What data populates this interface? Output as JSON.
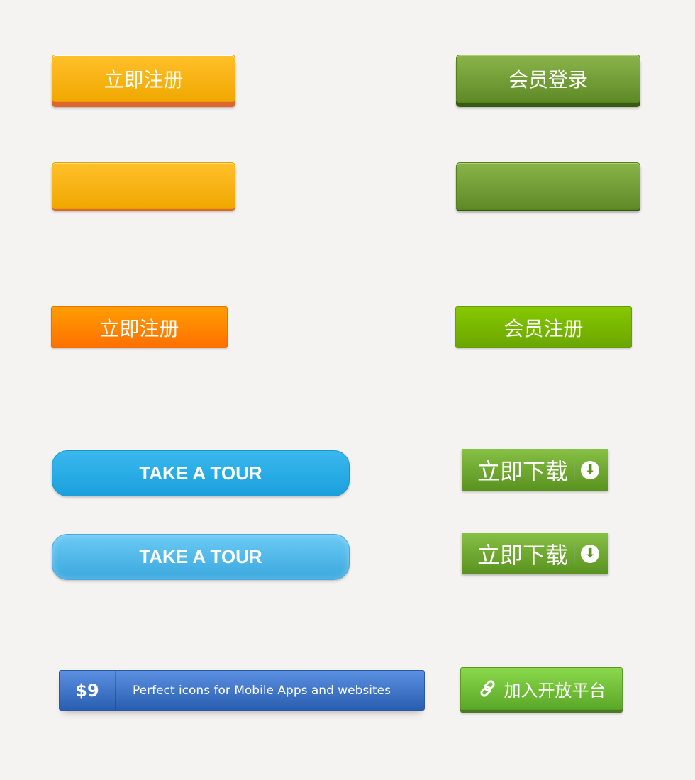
{
  "buttons": {
    "register_3d": "立即注册",
    "login_3d": "会员登录",
    "register_flat": "立即注册",
    "member_register_flat": "会员注册",
    "tour_1": "TAKE A TOUR",
    "tour_2": "TAKE A TOUR",
    "download_1": "立即下载",
    "download_2": "立即下载",
    "price": "$9",
    "banner_text": "Perfect icons for Mobile Apps and websites",
    "join": "加入开放平台"
  },
  "icons": {
    "download": "arrow-down-circle-icon",
    "link": "chain-link-icon"
  },
  "colors": {
    "orange": "#f0a800",
    "green": "#5e8a26",
    "orange_flat": "#ff7f00",
    "green_flat": "#76b600",
    "blue": "#1aa0dc",
    "banner_blue": "#2a5eb0"
  }
}
